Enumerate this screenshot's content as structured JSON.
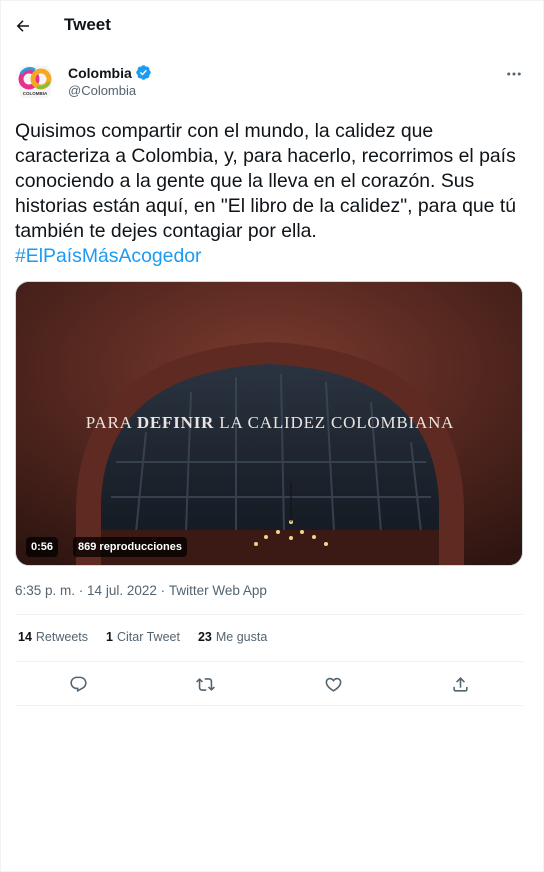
{
  "header": {
    "title": "Tweet",
    "back_icon": "arrow-left-icon"
  },
  "author": {
    "name": "Colombia",
    "handle": "@Colombia",
    "verified": true,
    "avatar_text": "CO",
    "avatar_subtext": "COLOMBIA",
    "more_icon": "more-horizontal-icon"
  },
  "tweet": {
    "text": "Quisimos compartir con el mundo, la calidez que caracteriza a Colombia, y, para hacerlo, recorrimos el país conociendo a la gente que la lleva en el corazón. Sus historias están aquí, en \"El libro de la calidez\", para que tú también te dejes contagiar por ella.",
    "hashtag": "#ElPaísMásAcogedor"
  },
  "media": {
    "overlay_prefix": "PARA ",
    "overlay_strong": "DEFINIR",
    "overlay_suffix": " LA CALIDEZ COLOMBIANA",
    "duration": "0:56",
    "views": "869 reproducciones"
  },
  "meta": {
    "time": "6:35 p. m.",
    "separator": " · ",
    "date": "14 jul. 2022",
    "app": "Twitter Web App"
  },
  "stats": {
    "retweets_count": "14",
    "retweets_label": "Retweets",
    "quotes_count": "1",
    "quotes_label": "Citar Tweet",
    "likes_count": "23",
    "likes_label": "Me gusta"
  },
  "actions": {
    "reply_icon": "reply-icon",
    "retweet_icon": "retweet-icon",
    "like_icon": "heart-icon",
    "share_icon": "share-icon"
  },
  "colors": {
    "accent": "#1d9bf0",
    "text": "#0f1419",
    "muted": "#536471",
    "divider": "#eff3f4"
  }
}
